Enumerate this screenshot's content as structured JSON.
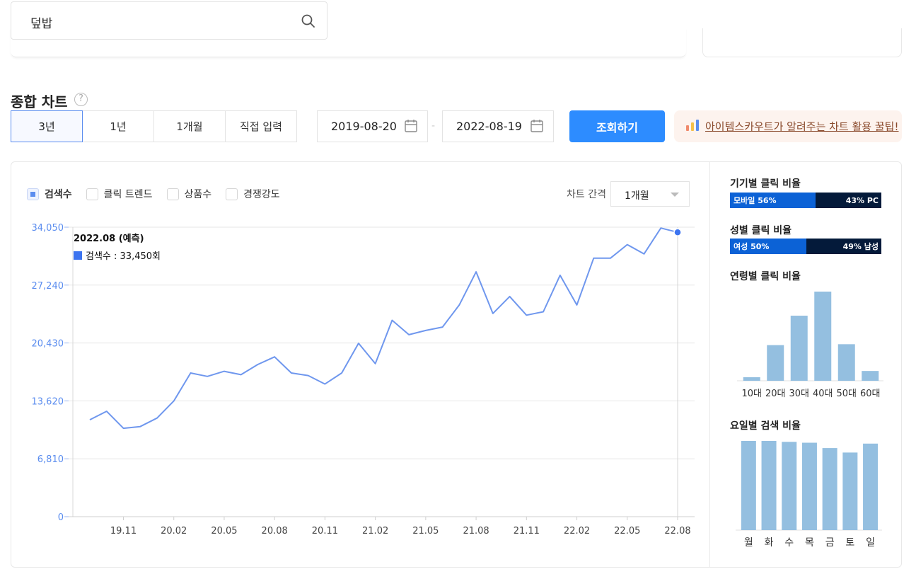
{
  "search": {
    "value": "덮밥",
    "icon": "search-icon"
  },
  "section": {
    "title": "종합 차트",
    "help": "?"
  },
  "period_tabs": [
    {
      "label": "3년",
      "active": true
    },
    {
      "label": "1년",
      "active": false
    },
    {
      "label": "1개월",
      "active": false
    },
    {
      "label": "직접 입력",
      "active": false
    }
  ],
  "date_range": {
    "start": "2019-08-20",
    "separator": "-",
    "end": "2022-08-19"
  },
  "query_button": "조회하기",
  "tip_link": "아이템스카우트가 알려주는 차트 활용 꿀팁!",
  "legend": [
    {
      "label": "검색수",
      "checked": true
    },
    {
      "label": "클릭 트렌드",
      "checked": false
    },
    {
      "label": "상품수",
      "checked": false
    },
    {
      "label": "경쟁강도",
      "checked": false
    }
  ],
  "interval": {
    "label": "차트 간격",
    "value": "1개월"
  },
  "tooltip": {
    "title": "2022.08 (예측)",
    "series": "검색수 : 33,450회"
  },
  "colors": {
    "line": "#6f97ee",
    "primary": "#2d8cff",
    "bar": "#94bfe0",
    "mobile": "#0c62d6",
    "pc": "#041a3a"
  },
  "chart_data": {
    "type": "line",
    "series": [
      {
        "name": "검색수",
        "values": [
          11400,
          12400,
          10400,
          10600,
          11600,
          13600,
          16900,
          16500,
          17100,
          16700,
          17900,
          18800,
          16900,
          16600,
          15600,
          16900,
          20400,
          18000,
          23100,
          21400,
          21900,
          22300,
          24900,
          28800,
          23900,
          25900,
          23700,
          24100,
          28400,
          24900,
          30400,
          30400,
          32000,
          30900,
          33950,
          33450
        ]
      }
    ],
    "x_ticks": [
      "19.11",
      "20.02",
      "20.05",
      "20.08",
      "20.11",
      "21.02",
      "21.05",
      "21.08",
      "21.11",
      "22.02",
      "22.05",
      "22.08"
    ],
    "y_ticks": [
      "34,050",
      "27,240",
      "20,430",
      "13,620",
      "6,810",
      "0"
    ],
    "ylim": [
      0,
      34050
    ],
    "grid": true
  },
  "device_ratio": {
    "title": "기기별 클릭 비율",
    "left_label": "모바일 56%",
    "left_value": 56,
    "right_label": "43% PC",
    "right_value": 43
  },
  "gender_ratio": {
    "title": "성별 클릭 비율",
    "left_label": "여성 50%",
    "left_value": 50,
    "right_label": "49% 남성",
    "right_value": 49
  },
  "age_chart": {
    "title": "연령별 클릭 비율",
    "categories": [
      "10대",
      "20대",
      "30대",
      "40대",
      "50대",
      "60대"
    ],
    "values": [
      4,
      40,
      73,
      100,
      41,
      11
    ]
  },
  "weekday_chart": {
    "title": "요일별 검색 비율",
    "categories": [
      "월",
      "화",
      "수",
      "목",
      "금",
      "토",
      "일"
    ],
    "values": [
      100,
      100,
      99,
      98,
      92,
      87,
      97
    ]
  }
}
